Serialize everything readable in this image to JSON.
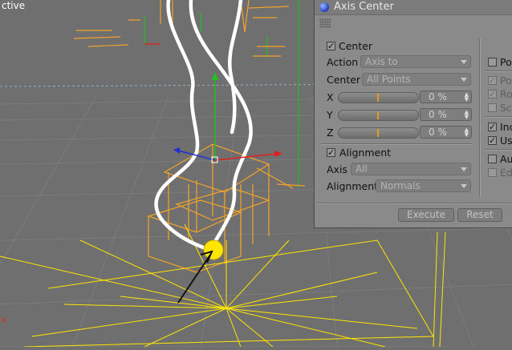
{
  "viewport": {
    "label": "ctive"
  },
  "dialog": {
    "title": "Axis Center",
    "center": {
      "label": "Center",
      "checked": true
    },
    "action": {
      "label": "Action",
      "value": "Axis to"
    },
    "center_mode": {
      "label": "Center",
      "value": "All Points"
    },
    "axes": [
      {
        "label": "X",
        "value": "0 %"
      },
      {
        "label": "Y",
        "value": "0 %"
      },
      {
        "label": "Z",
        "value": "0 %"
      }
    ],
    "alignment": {
      "label": "Alignment",
      "checked": true
    },
    "axis": {
      "label": "Axis",
      "value": "All"
    },
    "alignment_mode": {
      "label": "Alignment",
      "value": "Normals"
    },
    "right_options": [
      {
        "label": "Po",
        "checked": false,
        "enabled": true
      },
      {
        "label": "Po",
        "checked": true,
        "enabled": false
      },
      {
        "label": "Ro",
        "checked": true,
        "enabled": false
      },
      {
        "label": "Sc",
        "checked": false,
        "enabled": false
      },
      {
        "label": "Inc",
        "checked": true,
        "enabled": true
      },
      {
        "label": "Us",
        "checked": true,
        "enabled": true
      },
      {
        "label": "Au",
        "checked": false,
        "enabled": true
      },
      {
        "label": "Ed",
        "checked": false,
        "enabled": false
      }
    ],
    "execute_label": "Execute",
    "reset_label": "Reset"
  },
  "colors": {
    "wire": "#f2a32a",
    "selection": "#ffe600",
    "spline": "#ffffff",
    "axis_x": "#e02020",
    "axis_y": "#20c020",
    "axis_z": "#2030d0"
  }
}
